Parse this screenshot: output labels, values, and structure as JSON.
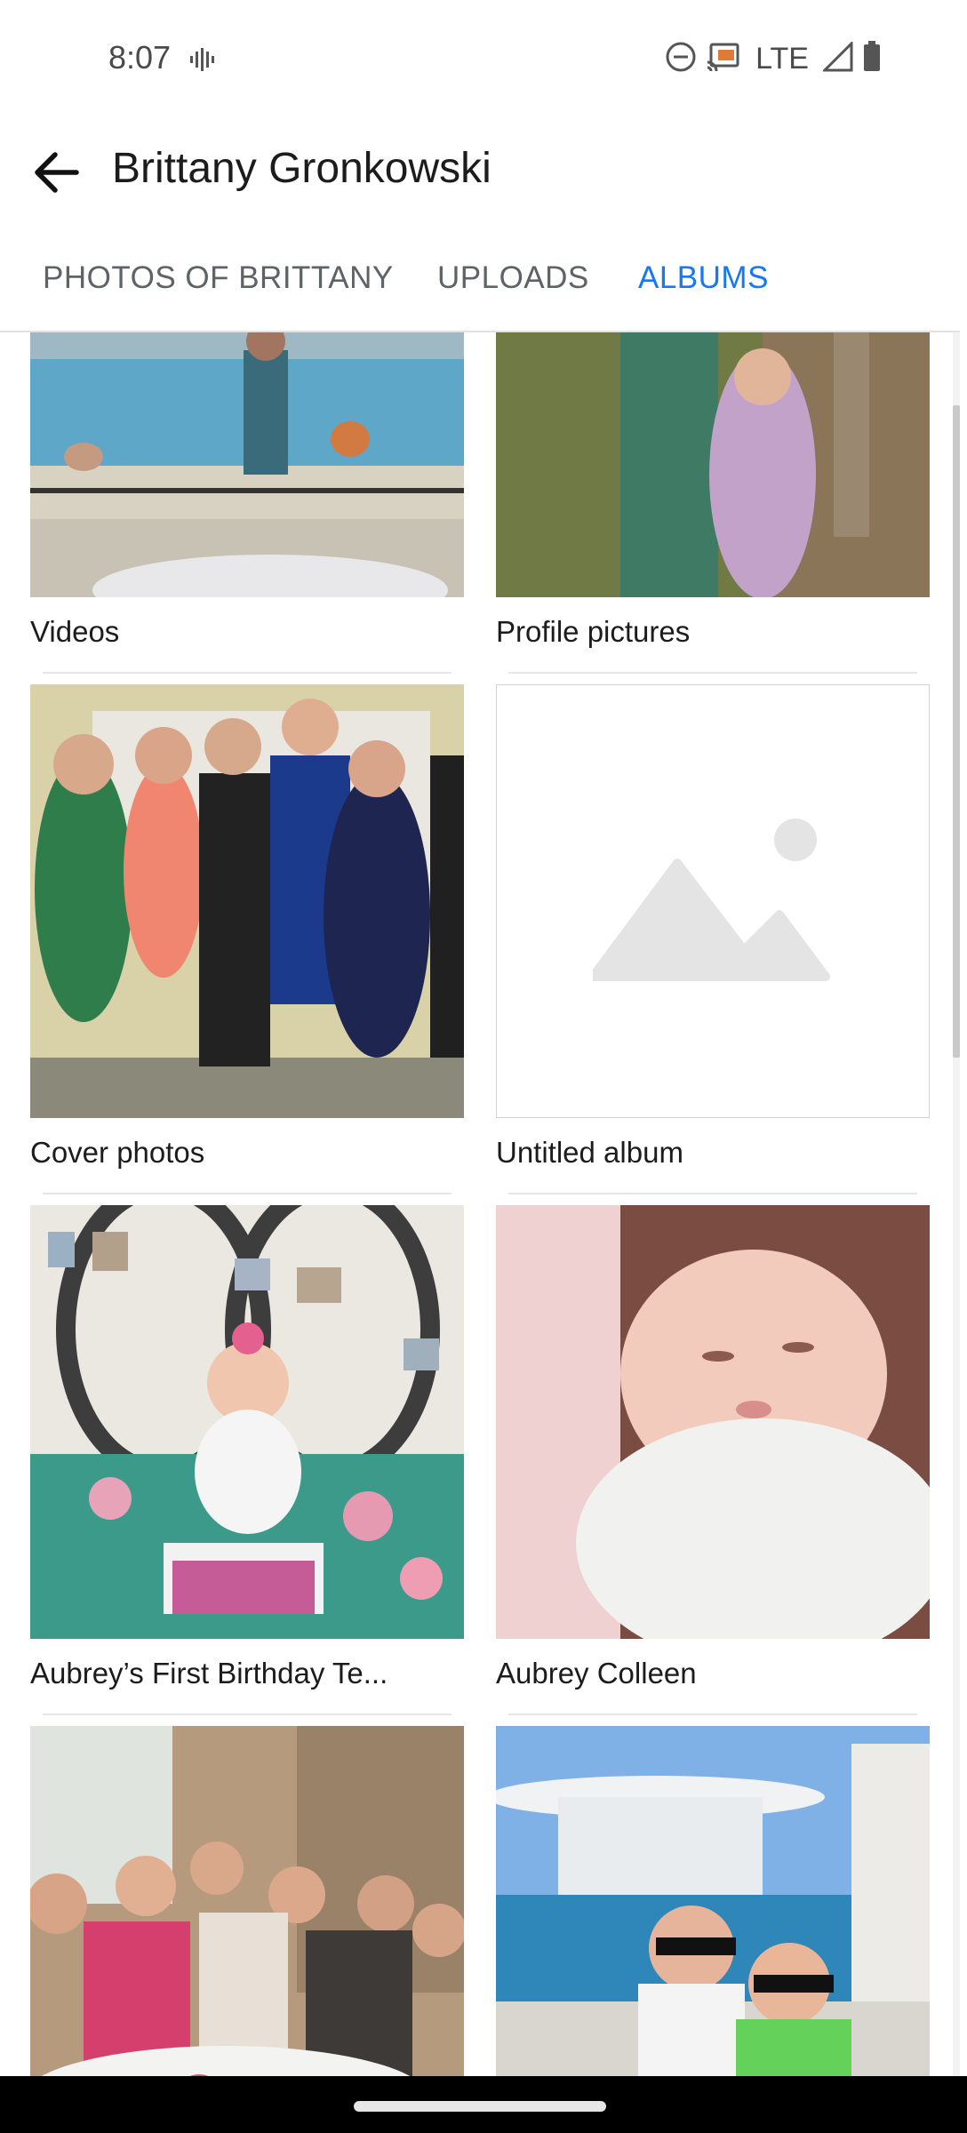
{
  "status_bar": {
    "time": "8:07",
    "network": "LTE",
    "icons": [
      "vibrate-icon",
      "do-not-disturb-icon",
      "cast-icon",
      "signal-icon",
      "battery-icon"
    ]
  },
  "app_bar": {
    "title": "Brittany Gronkowski",
    "back_icon": "arrow-back-icon"
  },
  "tabs": [
    {
      "label": "PHOTOS OF BRITTANY",
      "active": false
    },
    {
      "label": "UPLOADS",
      "active": false
    },
    {
      "label": "ALBUMS",
      "active": true
    }
  ],
  "albums": [
    {
      "label": "Videos"
    },
    {
      "label": "Profile pictures"
    },
    {
      "label": "Cover photos"
    },
    {
      "label": "Untitled album"
    },
    {
      "label": "Aubrey’s First Birthday Te..."
    },
    {
      "label": "Aubrey Colleen"
    },
    {
      "label": ""
    },
    {
      "label": ""
    }
  ],
  "colors": {
    "accent": "#1877f2",
    "tab_inactive": "#5f6368",
    "divider": "#e6e6e6"
  }
}
